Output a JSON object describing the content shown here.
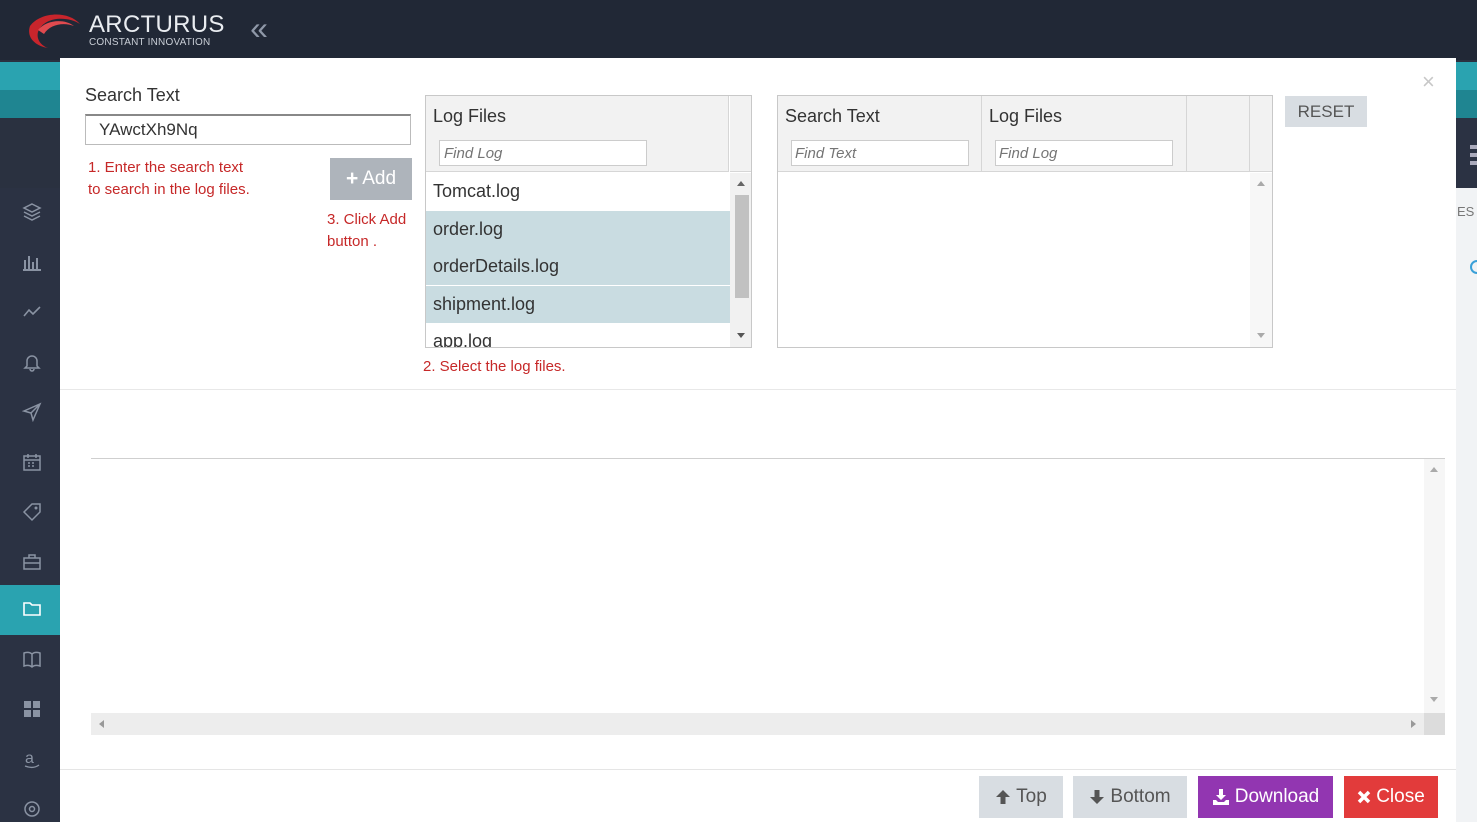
{
  "app": {
    "brand": "ARCTURUS",
    "tagline": "CONSTANT INNOVATION",
    "collapse_glyph": "«",
    "right_strip_text": "ES"
  },
  "icons": {
    "collapse": "double-chevron-left-icon",
    "sidebar": [
      "layers-icon",
      "bar-chart-icon",
      "line-chart-icon",
      "bell-icon",
      "send-icon",
      "calendar-icon",
      "tag-icon",
      "briefcase-icon",
      "folder-icon",
      "book-icon",
      "grid-icon",
      "amazon-icon",
      "settings-icon"
    ],
    "add": "plus-icon",
    "top": "arrow-up-icon",
    "bottom": "arrow-down-icon",
    "download": "download-icon",
    "close": "times-icon"
  },
  "colors": {
    "teal": "#2aa3b0",
    "download": "#9236b1",
    "close": "#e23b3b",
    "selected_row": "#c9dce1",
    "hint": "#c62828"
  },
  "modal": {
    "close_glyph": "×",
    "search_label": "Search Text",
    "search_value": "YAwctXh9Nq",
    "hint1": "1. Enter the search text\nto search in the log files.",
    "hint2": "2. Select the log files.",
    "hint3": "3. Click Add\nbutton .",
    "add_label": "Add",
    "reset_label": "RESET",
    "log_grid": {
      "header": "Log Files",
      "filter_placeholder": "Find Log",
      "rows": [
        {
          "name": "Tomcat.log",
          "selected": false
        },
        {
          "name": "order.log",
          "selected": true
        },
        {
          "name": "orderDetails.log",
          "selected": true
        },
        {
          "name": "shipment.log",
          "selected": true
        },
        {
          "name": "app.log",
          "selected": false
        }
      ]
    },
    "search_grid": {
      "col1_header": "Search Text",
      "col1_placeholder": "Find Text",
      "col2_header": "Log Files",
      "col2_placeholder": "Find Log"
    },
    "footer": {
      "top_label": "Top",
      "bottom_label": "Bottom",
      "download_label": "Download",
      "close_label": "Close"
    }
  }
}
